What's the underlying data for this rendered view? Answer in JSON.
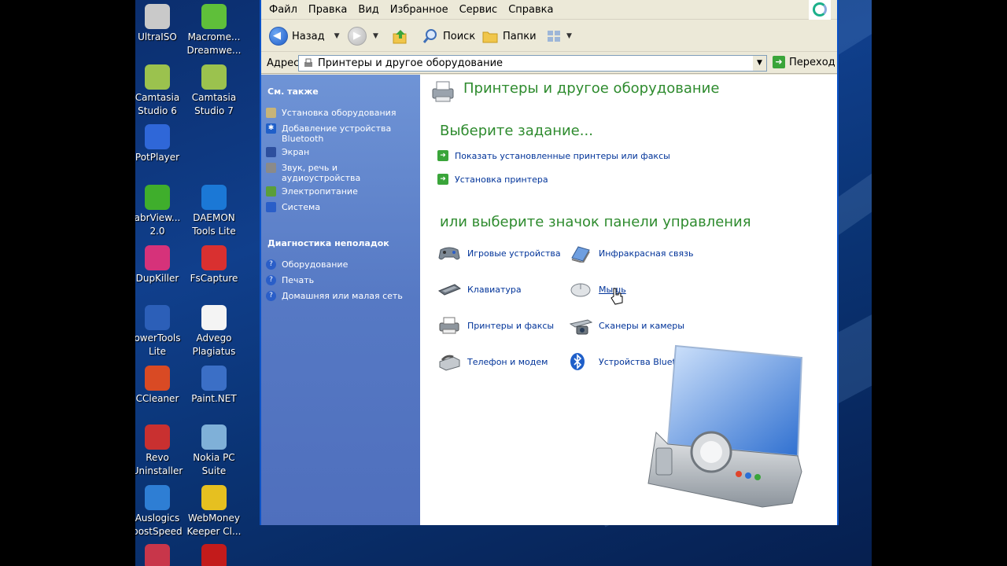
{
  "desktop": {
    "icons": [
      {
        "label": "UltraISO",
        "icon": "ultraiso-icon",
        "color": "#c9c9c9"
      },
      {
        "label": "Macrome...\nDreamwe...",
        "icon": "dreamweaver-icon",
        "color": "#5fbf3a"
      },
      {
        "label": "Camtasia\nStudio 6",
        "icon": "camtasia-icon",
        "color": "#9bc24e"
      },
      {
        "label": "Camtasia\nStudio 7",
        "icon": "camtasia-icon",
        "color": "#9bc24e"
      },
      {
        "label": "PotPlayer",
        "icon": "potplayer-icon",
        "color": "#2f67d8"
      },
      {
        "label": "abrView...\n2.0",
        "icon": "abrviewer-icon",
        "color": "#3fae2c"
      },
      {
        "label": "DAEMON\nTools Lite",
        "icon": "daemon-tools-icon",
        "color": "#1b78d6"
      },
      {
        "label": "DupKiller",
        "icon": "dupkiller-icon",
        "color": "#d6327a"
      },
      {
        "label": "FsCapture",
        "icon": "fscapture-icon",
        "color": "#d93030"
      },
      {
        "label": "owerTools\nLite",
        "icon": "powertools-icon",
        "color": "#2c5fb8"
      },
      {
        "label": "Advego\nPlagiatus",
        "icon": "advego-icon",
        "color": "#f4f4f4"
      },
      {
        "label": "CCleaner",
        "icon": "ccleaner-icon",
        "color": "#d94a24"
      },
      {
        "label": "Paint.NET",
        "icon": "paintnet-icon",
        "color": "#3b6fc6"
      },
      {
        "label": "Revo\nUninstaller",
        "icon": "revo-icon",
        "color": "#c93030"
      },
      {
        "label": "Nokia PC\nSuite",
        "icon": "nokia-icon",
        "color": "#7fb0d8"
      },
      {
        "label": "Auslogics\noostSpeed",
        "icon": "auslogics-icon",
        "color": "#2e7ed4"
      },
      {
        "label": "WebMoney\nKeeper Cl...",
        "icon": "webmoney-icon",
        "color": "#e6c020"
      },
      {
        "label": "",
        "icon": "floppy-icon",
        "color": "#c8364a"
      },
      {
        "label": "",
        "icon": "filezilla-icon",
        "color": "#c31b1b"
      }
    ]
  },
  "window": {
    "menu": [
      "Файл",
      "Правка",
      "Вид",
      "Избранное",
      "Сервис",
      "Справка"
    ],
    "toolbar": {
      "back_label": "Назад",
      "search_label": "Поиск",
      "folders_label": "Папки"
    },
    "address": {
      "label": "Адрес:",
      "value": "Принтеры и другое оборудование",
      "go_label": "Переход"
    },
    "taskpane": {
      "see_also_title": "См. также",
      "see_also": [
        "Установка оборудования",
        "Добавление устройства Bluetooth",
        "Экран",
        "Звук, речь и аудиоустройства",
        "Электропитание",
        "Система"
      ],
      "troubleshoot_title": "Диагностика неполадок",
      "troubleshoot": [
        "Оборудование",
        "Печать",
        "Домашняя или малая сеть"
      ]
    },
    "content": {
      "title": "Принтеры и другое оборудование",
      "pick_task": "Выберите задание...",
      "tasks": [
        "Показать установленные принтеры или факсы",
        "Установка принтера"
      ],
      "pick_icon": "или выберите значок панели управления",
      "items_left": [
        "Игровые устройства",
        "Клавиатура",
        "Принтеры и факсы",
        "Телефон и модем"
      ],
      "items_right": [
        "Инфракрасная связь",
        "Мышь",
        "Сканеры и камеры",
        "Устройства Bluetooth"
      ]
    }
  },
  "colors": {
    "accent_green": "#2e8b2e",
    "link_blue": "#003399",
    "taskpane_blue": "#5679c4",
    "xp_border": "#0b52c6"
  }
}
